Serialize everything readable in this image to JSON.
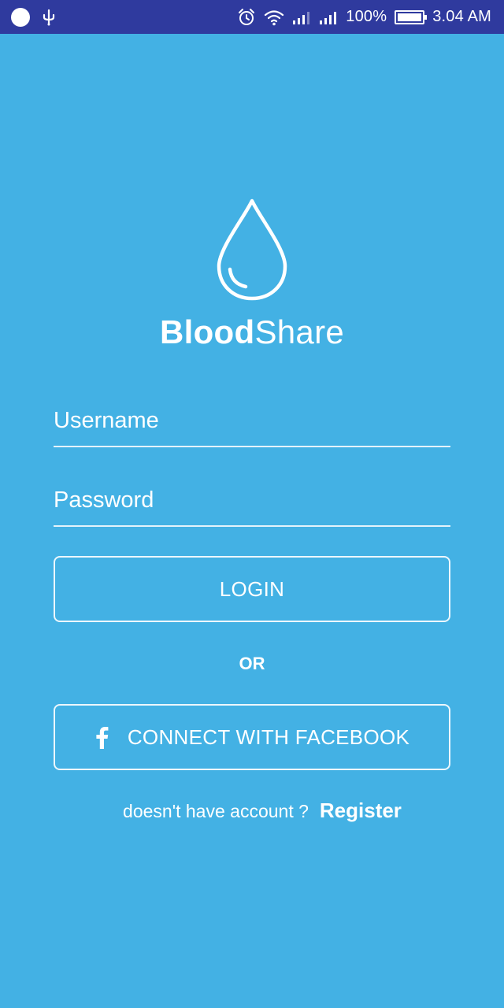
{
  "status_bar": {
    "battery_percent": "100%",
    "time": "3.04 AM",
    "battery_level": 1.0,
    "icons": [
      "notification-dot-icon",
      "usb-icon",
      "alarm-icon",
      "wifi-icon",
      "signal-icon",
      "signal-icon",
      "battery-icon"
    ]
  },
  "brand": {
    "bold": "Blood",
    "light": "Share"
  },
  "form": {
    "username_placeholder": "Username",
    "password_placeholder": "Password",
    "login_label": "LOGIN",
    "or_label": "OR",
    "facebook_label": "CONNECT WITH FACEBOOK"
  },
  "register": {
    "question": "doesn't have account ?",
    "link_label": "Register"
  },
  "colors": {
    "background": "#43b1e4",
    "status_bar": "#2f3a9e",
    "foreground": "#ffffff"
  }
}
